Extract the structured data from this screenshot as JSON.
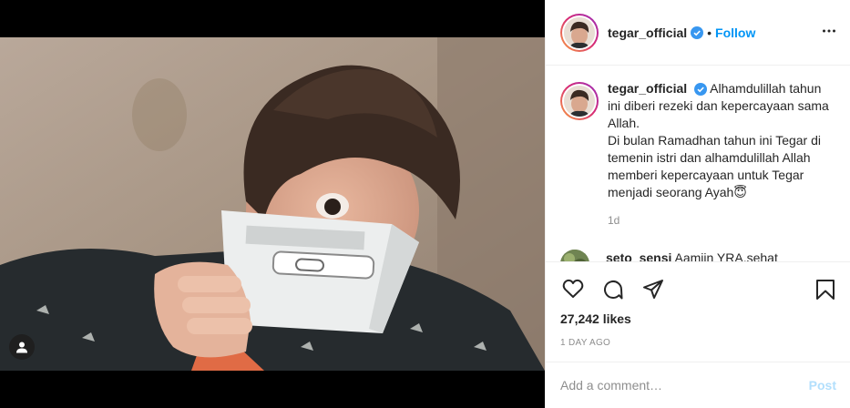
{
  "post": {
    "username": "tegar_official",
    "follow_label": "Follow",
    "separator": "•"
  },
  "caption": {
    "username": "tegar_official",
    "text": "Alhamdulillah tahun ini diberi rezeki dan kepercayaan sama Allah.",
    "text2": "Di bulan Ramadhan tahun ini Tegar di temenin istri dan alhamdulillah Allah memberi kepercayaan untuk Tegar menjadi seorang Ayah😇",
    "time": "1d"
  },
  "comment": {
    "username": "seto_sensi",
    "text": "Aamiin YRA,sehat"
  },
  "stats": {
    "likes": "27,242 likes",
    "time_ago": "1 DAY AGO"
  },
  "comment_box": {
    "placeholder": "Add a comment…",
    "post_label": "Post"
  },
  "colors": {
    "accent": "#0095f6",
    "post_disabled": "#b2dffc",
    "verified": "#3897f0"
  },
  "icons": [
    "verified-icon",
    "more-options-icon",
    "heart-icon",
    "comment-icon",
    "share-icon",
    "bookmark-icon",
    "user-tag-icon"
  ]
}
